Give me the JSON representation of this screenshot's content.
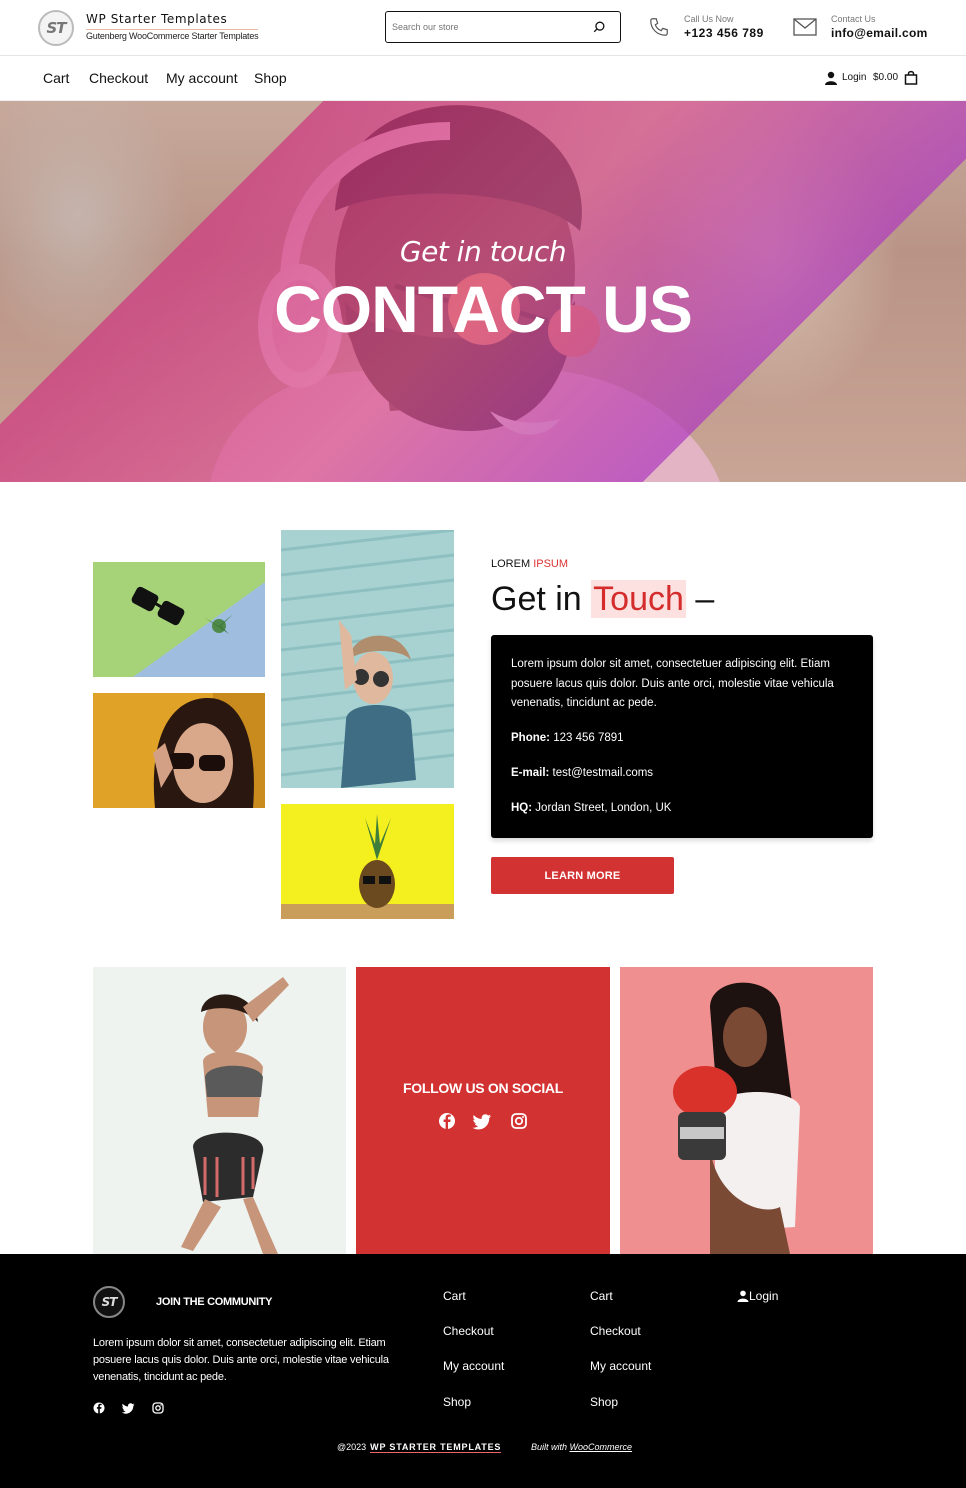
{
  "header": {
    "logo_text": "ST",
    "site_title": "WP Starter Templates",
    "site_tagline": "Gutenberg WooCommerce Starter Templates",
    "search_placeholder": "Search our store",
    "call_label": "Call Us Now",
    "call_value": "+123 456 789",
    "mail_label": "Contact Us",
    "mail_value": "info@email.com"
  },
  "nav": {
    "items": [
      "Cart",
      "Checkout",
      "My account",
      "Shop"
    ],
    "login_label": "Login",
    "cart_amount": "$0.00"
  },
  "hero": {
    "script": "Get in touch",
    "title": "CONTACT US"
  },
  "contact": {
    "eyebrow_a": "LOREM",
    "eyebrow_b": "IPSUM",
    "title_a": "Get in",
    "title_accent": "Touch",
    "title_dash": "–",
    "paragraph": "Lorem ipsum dolor sit amet, consectetuer adipiscing elit. Etiam posuere lacus quis dolor. Duis ante orci, molestie vitae vehicula venenatis, tincidunt ac pede.",
    "phone_label": "Phone:",
    "phone_value": "123 456 7891",
    "email_label": "E-mail:",
    "email_value": "test@testmail.coms",
    "hq_label": "HQ:",
    "hq_value": "Jordan Street, London, UK",
    "button_label": "LEARN MORE"
  },
  "social_tile": {
    "title": "FOLLOW US ON SOCIAL"
  },
  "footer": {
    "logo_text": "ST",
    "join_title": "JOIN THE COMMUNITY",
    "description": "Lorem ipsum dolor sit amet, consectetuer adipiscing elit. Etiam posuere lacus quis dolor. Duis ante orci, molestie vitae vehicula venenatis, tincidunt ac pede.",
    "col1": [
      "Cart",
      "Checkout",
      "My account",
      "Shop"
    ],
    "col2": [
      "Cart",
      "Checkout",
      "My account",
      "Shop"
    ],
    "login_label": "Login",
    "copyright_prefix": "@2023",
    "copyright_brand": "WP STARTER TEMPLATES",
    "built_with": "Built with",
    "built_link": "WooCommerce"
  },
  "colors": {
    "accent": "#d33232",
    "black": "#000000"
  }
}
